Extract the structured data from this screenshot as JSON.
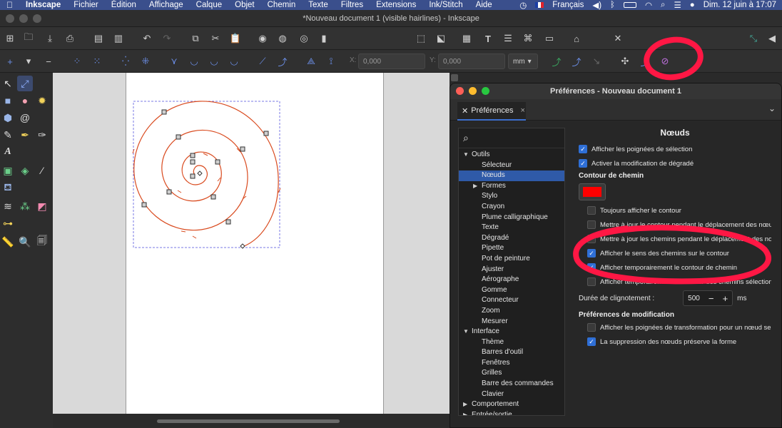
{
  "menubar": {
    "apple": "",
    "app": "Inkscape",
    "items": [
      "Fichier",
      "Édition",
      "Affichage",
      "Calque",
      "Objet",
      "Chemin",
      "Texte",
      "Filtres",
      "Extensions",
      "Ink/Stitch",
      "Aide"
    ],
    "input_source": "Français",
    "datetime": "Dim. 12 juin à 17:07"
  },
  "window": {
    "title": "*Nouveau document 1 (visible hairlines) - Inkscape"
  },
  "control_bar": {
    "x_label": "X:",
    "x_value": "0,000",
    "y_label": "Y:",
    "y_value": "0,000",
    "unit": "mm"
  },
  "preferences": {
    "window_title": "Préférences - Nouveau document 1",
    "tab_label": "Préférences",
    "page_title": "Nœuds",
    "tree": [
      {
        "label": "Outils",
        "level": 0,
        "arrow": "▼"
      },
      {
        "label": "Sélecteur",
        "level": 1
      },
      {
        "label": "Nœuds",
        "level": 1,
        "selected": true
      },
      {
        "label": "Formes",
        "level": 1,
        "arrow": "▶"
      },
      {
        "label": "Stylo",
        "level": 1
      },
      {
        "label": "Crayon",
        "level": 1
      },
      {
        "label": "Plume calligraphique",
        "level": 1
      },
      {
        "label": "Texte",
        "level": 1
      },
      {
        "label": "Dégradé",
        "level": 1
      },
      {
        "label": "Pipette",
        "level": 1
      },
      {
        "label": "Pot de peinture",
        "level": 1
      },
      {
        "label": "Ajuster",
        "level": 1
      },
      {
        "label": "Aérographe",
        "level": 1
      },
      {
        "label": "Gomme",
        "level": 1
      },
      {
        "label": "Connecteur",
        "level": 1
      },
      {
        "label": "Zoom",
        "level": 1
      },
      {
        "label": "Mesurer",
        "level": 1
      },
      {
        "label": "Interface",
        "level": 0,
        "arrow": "▼"
      },
      {
        "label": "Thème",
        "level": 1
      },
      {
        "label": "Barres d'outil",
        "level": 1
      },
      {
        "label": "Fenêtres",
        "level": 1
      },
      {
        "label": "Grilles",
        "level": 1
      },
      {
        "label": "Barre des commandes",
        "level": 1
      },
      {
        "label": "Clavier",
        "level": 1
      },
      {
        "label": "Comportement",
        "level": 0,
        "arrow": "▶"
      },
      {
        "label": "Entrée/sortie",
        "level": 0,
        "arrow": "▶"
      }
    ],
    "options": {
      "show_select_handles": {
        "label": "Afficher les poignées de sélection",
        "checked": true
      },
      "gradient_edit": {
        "label": "Activer la modification de dégradé",
        "checked": true
      },
      "path_outline_title": "Contour de chemin",
      "outline_color": "#ff0000",
      "always_show_outline": {
        "label": "Toujours afficher le contour",
        "checked": false
      },
      "update_outline_drag": {
        "label": "Mettre à jour le contour pendant le déplacement des nœuds",
        "checked": false
      },
      "update_paths_drag": {
        "label": "Mettre à jour les chemins pendant le déplacement des nœuds",
        "checked": false
      },
      "show_path_direction": {
        "label": "Afficher le sens des chemins sur le contour",
        "checked": true
      },
      "temp_path_outline": {
        "label": "Afficher temporairement le contour de chemin",
        "checked": true
      },
      "temp_selected_outline": {
        "label": "Afficher temporairement le contour des chemins sélectionnés",
        "checked": false
      },
      "flash_duration_label": "Durée de clignotement :",
      "flash_duration_value": "500",
      "flash_duration_unit": "ms",
      "edit_prefs_title": "Préférences de modification",
      "transform_handles_single": {
        "label": "Afficher les poignées de transformation pour un nœud seul",
        "checked": false
      },
      "delete_preserves_shape": {
        "label": "La suppression des nœuds préserve la forme",
        "checked": true
      }
    }
  },
  "colors": {
    "menubar_bg": "#3a4f8c",
    "selection_blue": "#2f5aa8",
    "checkbox_blue": "#2f6fd6",
    "spiral_stroke": "#d94a1e",
    "annotation_red": "#ff1744"
  }
}
